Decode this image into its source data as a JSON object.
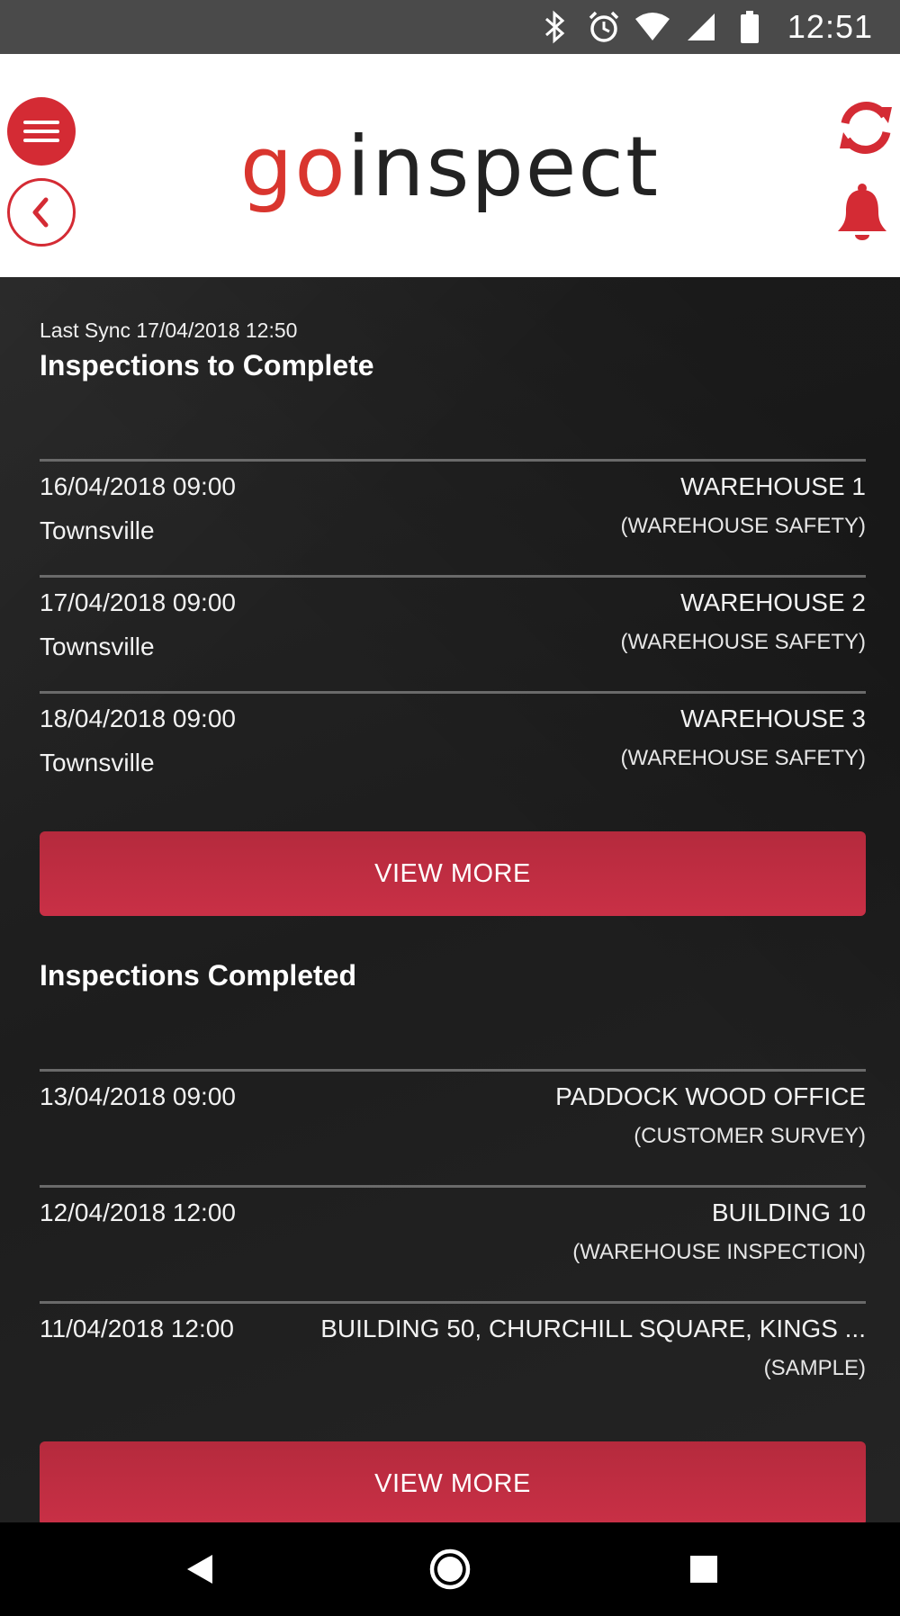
{
  "status_bar": {
    "time": "12:51",
    "icons": [
      "bluetooth-icon",
      "alarm-icon",
      "wifi-icon",
      "signal-icon",
      "battery-icon"
    ]
  },
  "header": {
    "logo_part1": "go",
    "logo_part2": "inspect",
    "colors": {
      "accent": "#d42b34",
      "logo_go": "#d9352e",
      "logo_inspect": "#222222"
    },
    "icons": [
      "menu-icon",
      "back-icon",
      "sync-icon",
      "bell-icon"
    ]
  },
  "last_sync": "Last Sync 17/04/2018 12:50",
  "to_complete": {
    "title": "Inspections to Complete",
    "items": [
      {
        "date": "16/04/2018 09:00",
        "location": "Townsville",
        "site": "WAREHOUSE 1",
        "type": "(WAREHOUSE SAFETY)"
      },
      {
        "date": "17/04/2018 09:00",
        "location": "Townsville",
        "site": "WAREHOUSE 2",
        "type": "(WAREHOUSE SAFETY)"
      },
      {
        "date": "18/04/2018 09:00",
        "location": "Townsville",
        "site": "WAREHOUSE 3",
        "type": "(WAREHOUSE SAFETY)"
      }
    ],
    "view_more_label": "VIEW MORE"
  },
  "completed": {
    "title": "Inspections Completed",
    "items": [
      {
        "date": "13/04/2018 09:00",
        "location": "",
        "site": "PADDOCK WOOD OFFICE",
        "type": "(CUSTOMER SURVEY)"
      },
      {
        "date": "12/04/2018 12:00",
        "location": "",
        "site": "BUILDING 10",
        "type": "(WAREHOUSE INSPECTION)"
      },
      {
        "date": "11/04/2018 12:00",
        "location": "",
        "site": "BUILDING 50, CHURCHILL SQUARE, KINGS ...",
        "type": "(SAMPLE)"
      }
    ],
    "view_more_label": "VIEW MORE"
  },
  "nav_bar": {
    "icons": [
      "nav-back-icon",
      "nav-home-icon",
      "nav-recent-icon"
    ]
  }
}
